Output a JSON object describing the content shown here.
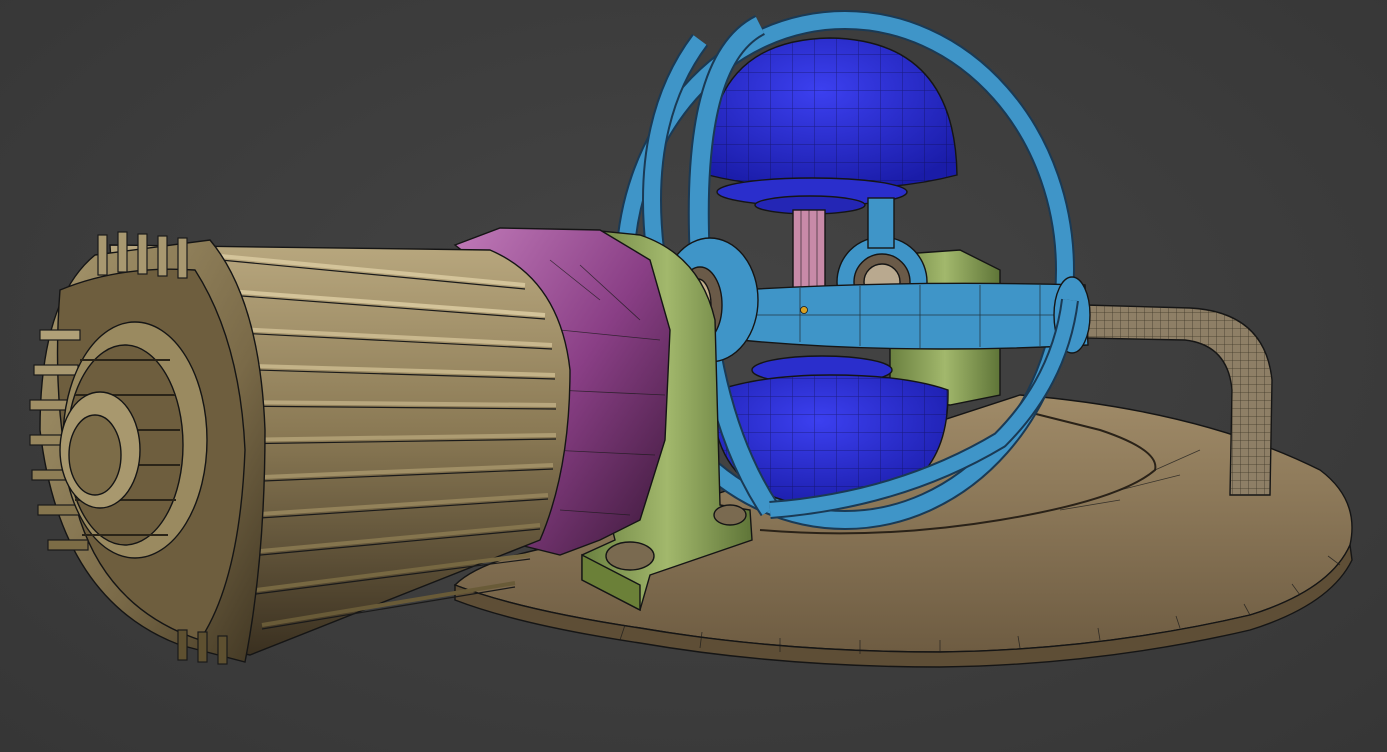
{
  "viewport": {
    "background": "#3d3d3d",
    "shading_mode": "shaded-wireframe"
  },
  "objects": {
    "base_disc": {
      "color": "#8e7a5c"
    },
    "motor_housing": {
      "color": "#8a7a58"
    },
    "gearbox": {
      "color": "#9b4f95"
    },
    "bearing_blocks": {
      "color": "#7f9a4e"
    },
    "gyro_rings": {
      "color": "#3f95c8"
    },
    "hemispheres": {
      "color": "#1f22c8"
    },
    "spindle": {
      "color": "#c88aa8"
    },
    "pipe": {
      "color": "#8e7f66"
    }
  }
}
